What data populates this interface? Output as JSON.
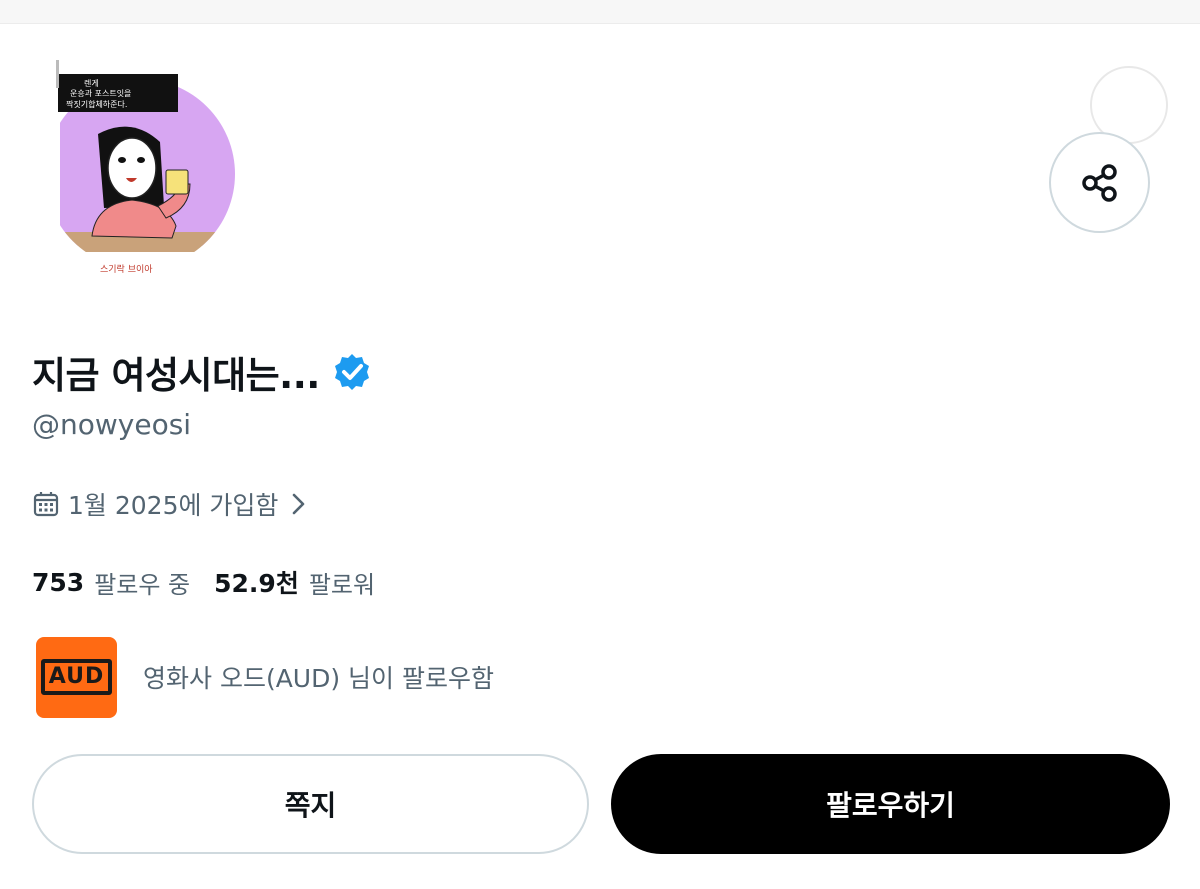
{
  "profile": {
    "display_name": "지금 여성시대는...",
    "handle": "@nowyeosi",
    "joined": "1월 2025에 가입함",
    "following_count": "753",
    "following_label": "팔로우 중",
    "followers_count": "52.9천",
    "followers_label": "팔로워",
    "verified": true
  },
  "followed_by": {
    "logo_text": "AUD",
    "text": "영화사 오드(AUD) 님이 팔로우함"
  },
  "actions": {
    "message_label": "쪽지",
    "follow_label": "팔로우하기"
  },
  "icons": {
    "share": "share-icon",
    "verified": "verified-badge-icon",
    "calendar": "calendar-icon",
    "chevron": "chevron-right-icon"
  },
  "colors": {
    "verified_blue": "#1d9bf0",
    "aud_orange": "#ff6a13",
    "follow_button": "#000000",
    "secondary_text": "#536471"
  }
}
